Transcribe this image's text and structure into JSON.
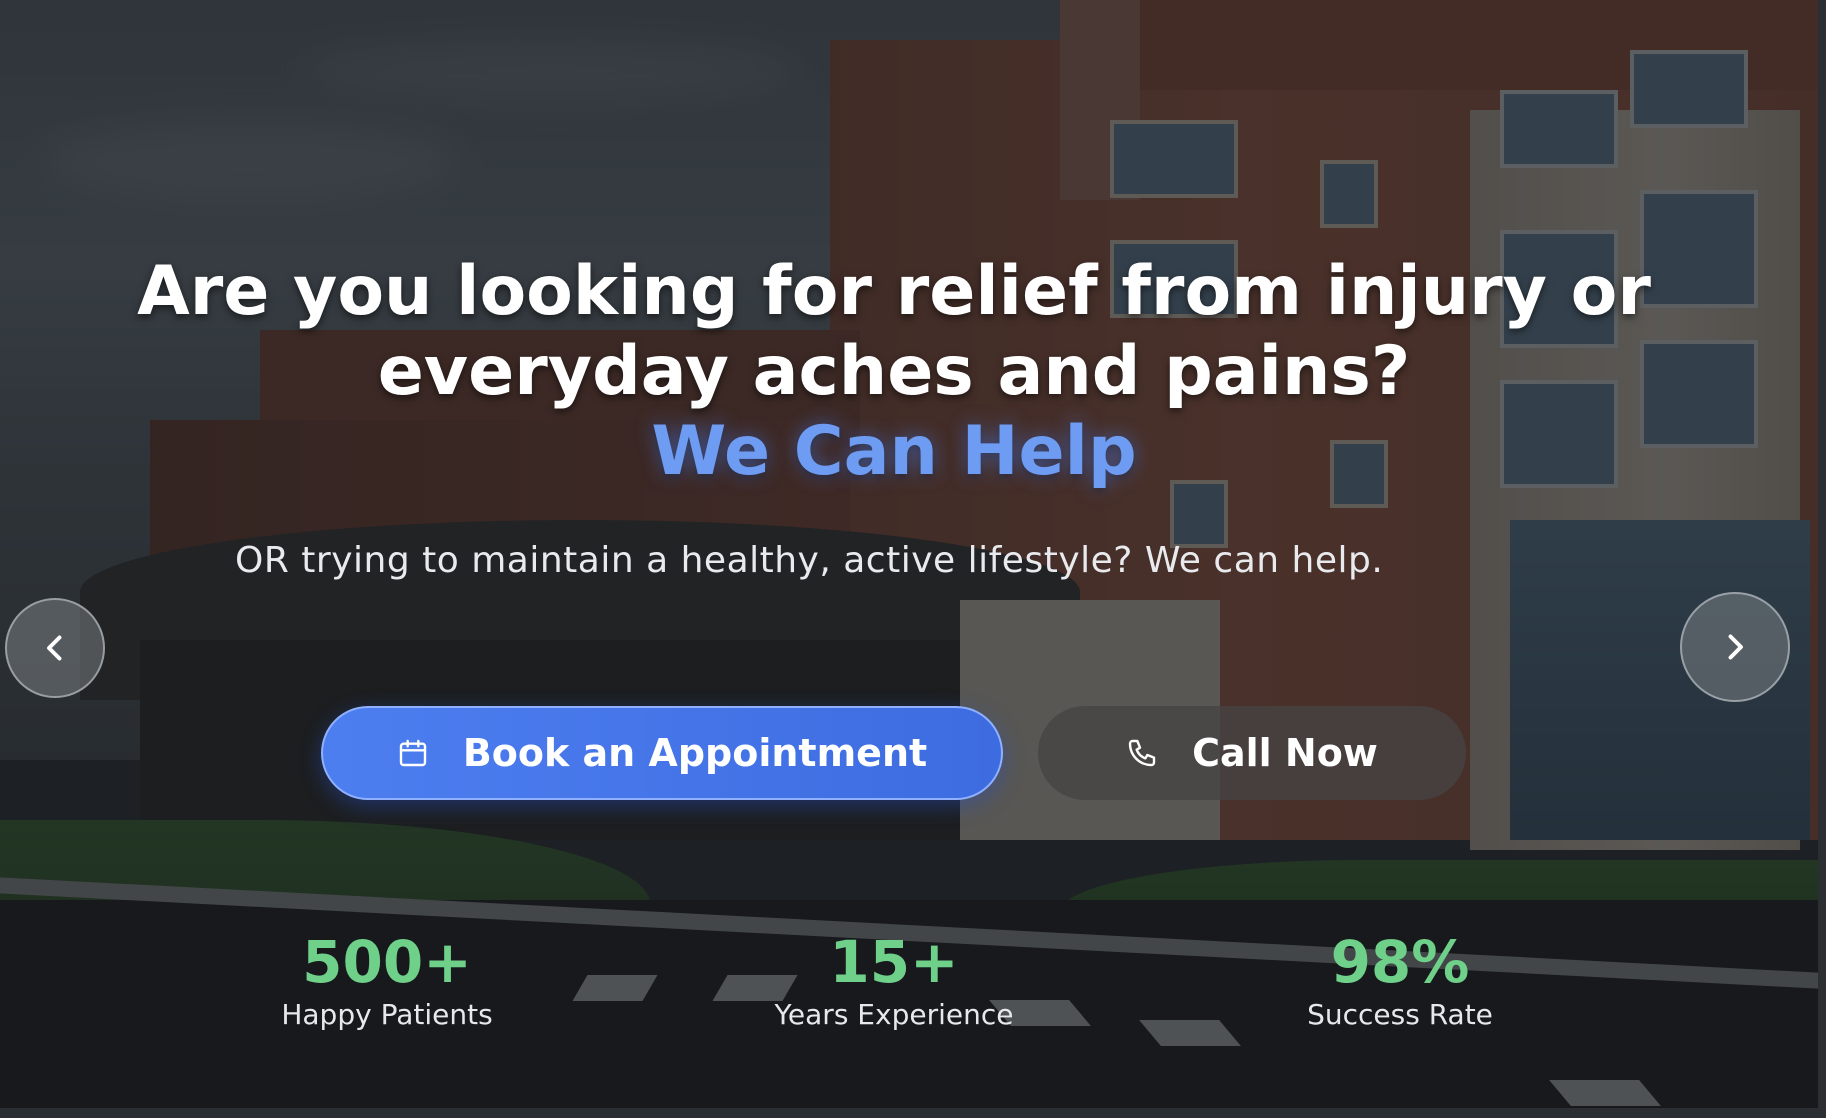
{
  "hero": {
    "headline_line1": "Are you looking for relief from injury or",
    "headline_line2": "everyday aches and pains?",
    "headline_accent": "We Can Help",
    "subtext": "OR trying to maintain a healthy, active lifestyle? We can help."
  },
  "buttons": {
    "book_label": "Book an Appointment",
    "book_icon": "calendar-icon",
    "call_label": "Call Now",
    "call_icon": "phone-icon"
  },
  "carousel": {
    "prev_icon": "chevron-left-icon",
    "next_icon": "chevron-right-icon"
  },
  "stats": [
    {
      "value": "500+",
      "label": "Happy Patients"
    },
    {
      "value": "15+",
      "label": "Years Experience"
    },
    {
      "value": "98%",
      "label": "Success Rate"
    }
  ],
  "colors": {
    "accent_blue": "#6e9cf2",
    "button_blue": "#4d7ef0",
    "stat_green": "#6fd08a"
  }
}
